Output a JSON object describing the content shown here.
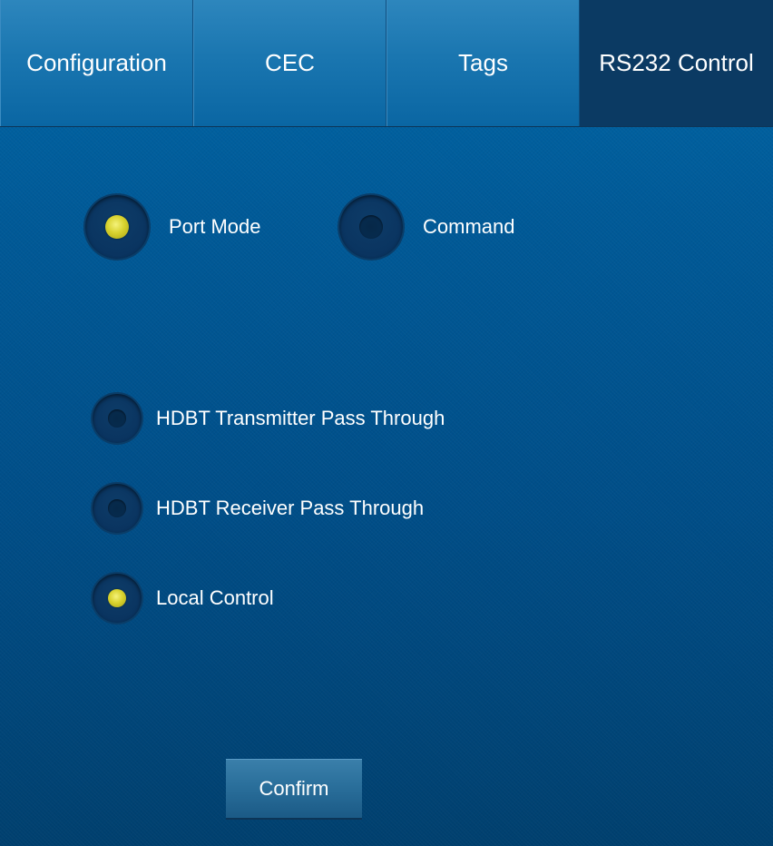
{
  "tabs": [
    {
      "label": "Configuration",
      "active": false
    },
    {
      "label": "CEC",
      "active": false
    },
    {
      "label": "Tags",
      "active": false
    },
    {
      "label": "RS232 Control",
      "active": true
    }
  ],
  "mode": {
    "options": [
      {
        "label": "Port Mode",
        "selected": true
      },
      {
        "label": "Command",
        "selected": false
      }
    ]
  },
  "passthrough": {
    "options": [
      {
        "label": "HDBT Transmitter Pass Through",
        "selected": false
      },
      {
        "label": "HDBT Receiver Pass Through",
        "selected": false
      },
      {
        "label": "Local Control",
        "selected": true
      }
    ]
  },
  "confirm_label": "Confirm",
  "colors": {
    "accent_selected": "#d8d22e",
    "tab_active": "#0b3a63",
    "tab_inactive": "#1a76b0",
    "background": "#00467c"
  }
}
